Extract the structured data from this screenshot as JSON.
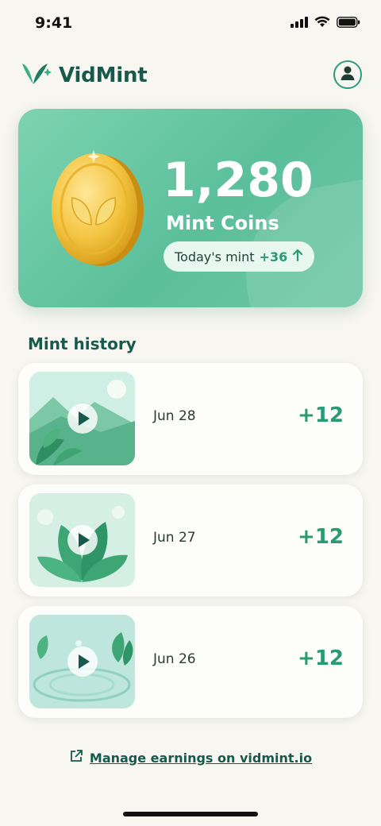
{
  "status_bar": {
    "time": "9:41"
  },
  "header": {
    "app_name": "VidMint",
    "brand_color": "#17594a",
    "accent_color": "#2e9c7c"
  },
  "balance": {
    "amount": "1,280",
    "label": "Mint Coins",
    "today_label": "Today's mint",
    "today_delta": "+36",
    "coin_icon": "leaf-coin-icon"
  },
  "history": {
    "title": "Mint history",
    "items": [
      {
        "date": "Jun 28",
        "amount": "+12",
        "thumb": "mint-valley"
      },
      {
        "date": "Jun 27",
        "amount": "+12",
        "thumb": "mint-leaves-dew"
      },
      {
        "date": "Jun 26",
        "amount": "+12",
        "thumb": "water-ripple-mint"
      }
    ]
  },
  "footer": {
    "manage_link": "Manage earnings on vidmint.io"
  },
  "icons": [
    "signal-icon",
    "wifi-icon",
    "battery-icon",
    "profile-icon",
    "play-icon",
    "external-link-icon",
    "arrow-up-icon"
  ]
}
